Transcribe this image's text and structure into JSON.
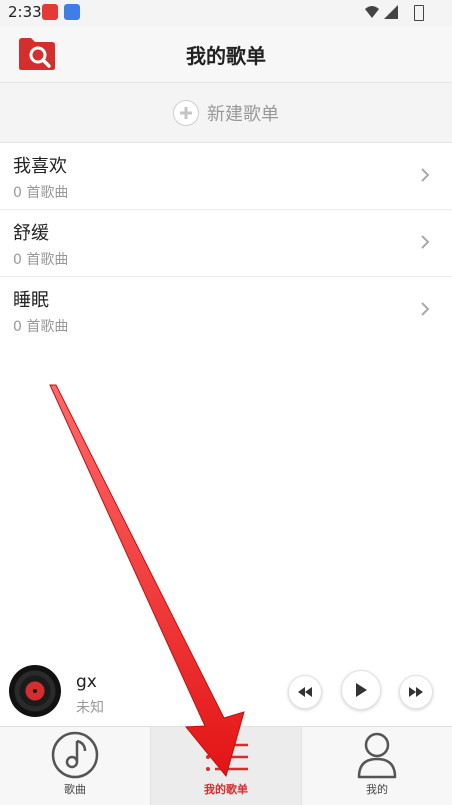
{
  "status_bar": {
    "time": "2:33"
  },
  "header": {
    "title": "我的歌单"
  },
  "new_playlist": {
    "label": "新建歌单"
  },
  "playlists": [
    {
      "name": "我喜欢",
      "count": "0 首歌曲"
    },
    {
      "name": "舒缓",
      "count": "0 首歌曲"
    },
    {
      "name": "睡眠",
      "count": "0 首歌曲"
    }
  ],
  "player": {
    "title": "gx",
    "artist": "未知"
  },
  "tabs": [
    {
      "label": "歌曲",
      "active": false
    },
    {
      "label": "我的歌单",
      "active": true
    },
    {
      "label": "我的",
      "active": false
    }
  ],
  "colors": {
    "accent": "#d32f2f",
    "annotation": "#e32020"
  }
}
